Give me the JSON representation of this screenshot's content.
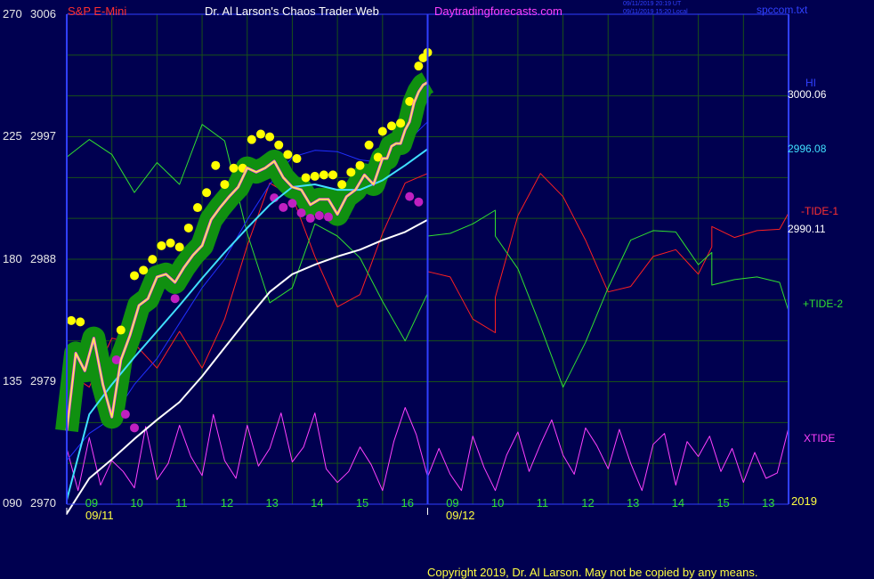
{
  "header": {
    "symbol": "S&P E-Mini",
    "title": "Dr. Al Larson's Chaos Trader Web",
    "site": "Daytradingforecasts.com",
    "stamp_line1": "09/11/2019 20:19 UT",
    "stamp_line2": "09/11/2019 15:20 Local",
    "file": "spccom.txt"
  },
  "copyright": "Copyright 2019, Dr. Al Larson. May not be copied by any means.",
  "colors": {
    "background": "#000050",
    "grid": "#185018",
    "frame": "#3040ff",
    "price": "#ffff40",
    "mid": "#ff40ff",
    "band": "#109010",
    "balls": "#ffff00",
    "low_balls": "#c020c0",
    "ma_fast": "#40e0ff",
    "ma_slow": "#ffffff",
    "ma_blue": "#2030ff",
    "tide1": "#ff2020",
    "tide2": "#30e030",
    "xtide": "#ff40ff"
  },
  "chart_data": {
    "type": "line",
    "title": "S&P E-Mini",
    "y_left_scale": [
      {
        "osc": "270",
        "price": "3006"
      },
      {
        "osc": "225",
        "price": "2997"
      },
      {
        "osc": "180",
        "price": "2988"
      },
      {
        "osc": "135",
        "price": "2979"
      },
      {
        "osc": "090",
        "price": "2970"
      }
    ],
    "ylim": [
      2970,
      3006
    ],
    "x_ticks": [
      "09",
      "10",
      "11",
      "12",
      "13",
      "14",
      "15",
      "16",
      "09",
      "10",
      "11",
      "12",
      "13",
      "14",
      "15",
      "13"
    ],
    "date_labels": [
      "09/11",
      "09/12"
    ],
    "year_label": "2019",
    "right_labels": {
      "hi_label": "HI",
      "hi_value": "3000.06",
      "ma_fast_value": "2996.08",
      "tide1": "-TIDE-1",
      "ma_slow_value": "2990.11",
      "tide2": "+TIDE-2",
      "xtide": "XTIDE"
    },
    "series": [
      {
        "key": "price",
        "x": [
          0.0,
          0.2,
          0.4,
          0.6,
          0.8,
          1.0,
          1.2,
          1.4,
          1.6,
          1.8,
          2.0,
          2.2,
          2.4,
          2.6,
          2.8,
          3.0,
          3.2,
          3.4,
          3.6,
          3.8,
          4.0,
          4.2,
          4.4,
          4.6,
          4.8,
          5.0,
          5.2,
          5.4,
          5.6,
          5.8,
          6.0,
          6.2,
          6.4,
          6.6,
          6.8,
          7.0,
          7.1,
          7.2,
          7.3,
          7.4,
          7.5,
          7.6,
          7.7,
          7.8,
          7.9,
          8.0
        ],
        "values": [
          2975.4,
          2981.1,
          2979.8,
          2982.2,
          2978.8,
          2976.4,
          2980.6,
          2982.4,
          2984.6,
          2985.1,
          2986.7,
          2986.9,
          2986.3,
          2987.4,
          2988.3,
          2989.0,
          2990.9,
          2991.8,
          2992.6,
          2993.3,
          2994.7,
          2994.4,
          2994.7,
          2995.2,
          2994.0,
          2993.3,
          2993.1,
          2992.0,
          2992.4,
          2992.4,
          2991.3,
          2992.6,
          2993.1,
          2994.2,
          2993.5,
          2995.4,
          2995.4,
          2996.3,
          2996.5,
          2996.5,
          2997.5,
          2998.1,
          2999.5,
          3000.3,
          3000.8,
          3001.0
        ]
      },
      {
        "key": "ma_fast",
        "x": [
          0,
          0.5,
          1,
          1.5,
          2,
          2.5,
          3,
          3.5,
          4,
          4.5,
          5,
          5.5,
          6,
          6.5,
          7,
          7.5,
          8
        ],
        "values": [
          2970.3,
          2976.6,
          2978.8,
          2980.8,
          2982.7,
          2984.6,
          2986.6,
          2988.5,
          2990.3,
          2992.0,
          2993.3,
          2993.5,
          2993.1,
          2993.1,
          2993.8,
          2994.9,
          2996.1
        ]
      },
      {
        "key": "ma_slow",
        "x": [
          0,
          0.5,
          1,
          1.5,
          2,
          2.5,
          3,
          3.5,
          4,
          4.5,
          5,
          5.5,
          6,
          6.5,
          7,
          7.5,
          8
        ],
        "values": [
          2969.3,
          2971.9,
          2973.3,
          2974.8,
          2976.2,
          2977.5,
          2979.4,
          2981.5,
          2983.6,
          2985.6,
          2986.9,
          2987.6,
          2988.2,
          2988.7,
          2989.4,
          2990.0,
          2990.9
        ]
      },
      {
        "key": "ma_blue",
        "x": [
          0,
          0.5,
          1,
          1.5,
          2,
          2.5,
          3,
          3.5,
          4,
          4.5,
          5,
          5.5,
          6,
          6.5,
          7,
          7.5,
          8
        ],
        "values": [
          2973.2,
          2975.2,
          2976.3,
          2978.8,
          2980.7,
          2983.3,
          2985.9,
          2988.0,
          2990.9,
          2993.5,
          2995.5,
          2996.0,
          2995.9,
          2995.3,
          2995.1,
          2996.5,
          2998.1
        ]
      },
      {
        "key": "tide1",
        "x": [
          0.0,
          0.5,
          1.0,
          1.5,
          2.0,
          2.5,
          3.0,
          3.5,
          4.0,
          4.5,
          5.0,
          5.5,
          6.0,
          6.5,
          7.0,
          7.5,
          8.0,
          8.0,
          8.5,
          9.0,
          9.5,
          9.5,
          10.0,
          10.5,
          11.0,
          11.5,
          12.0,
          12.5,
          13.0,
          13.5,
          14.0,
          14.3,
          14.3,
          14.8,
          15.3,
          15.8,
          16.0
        ],
        "values": [
          2979.7,
          2978.6,
          2982.2,
          2981.8,
          2980.0,
          2982.7,
          2980.0,
          2983.6,
          2989.0,
          2993.6,
          2992.6,
          2988.2,
          2984.5,
          2985.4,
          2989.9,
          2993.6,
          2994.3,
          2987.1,
          2986.7,
          2983.6,
          2982.6,
          2985.2,
          2991.2,
          2994.3,
          2992.6,
          2989.4,
          2985.6,
          2986.0,
          2988.2,
          2988.7,
          2986.9,
          2988.9,
          2990.4,
          2989.6,
          2990.1,
          2990.2,
          2991.4
        ]
      },
      {
        "key": "tide2",
        "x": [
          0.0,
          0.5,
          1.0,
          1.5,
          2.0,
          2.5,
          3.0,
          3.5,
          4.0,
          4.5,
          5.0,
          5.5,
          6.0,
          6.5,
          7.0,
          7.5,
          8.0,
          8.0,
          8.5,
          9.0,
          9.5,
          9.5,
          10.0,
          10.5,
          11.0,
          11.5,
          12.0,
          12.5,
          13.0,
          13.5,
          14.0,
          14.3,
          14.3,
          14.8,
          15.3,
          15.8,
          16.0
        ],
        "values": [
          2995.5,
          2996.8,
          2995.7,
          2992.9,
          2995.1,
          2993.5,
          2997.9,
          2996.7,
          2989.9,
          2984.8,
          2985.9,
          2990.6,
          2989.7,
          2988.1,
          2984.9,
          2982.0,
          2985.5,
          2989.7,
          2989.9,
          2990.6,
          2991.6,
          2989.7,
          2987.3,
          2983.1,
          2978.6,
          2981.9,
          2985.9,
          2989.4,
          2990.1,
          2990.0,
          2987.6,
          2988.5,
          2986.1,
          2986.5,
          2986.7,
          2986.3,
          2984.2
        ]
      },
      {
        "key": "xtide",
        "x": [
          0.0,
          0.25,
          0.5,
          0.75,
          1.0,
          1.25,
          1.5,
          1.75,
          2.0,
          2.25,
          2.5,
          2.75,
          3.0,
          3.25,
          3.5,
          3.75,
          4.0,
          4.25,
          4.5,
          4.75,
          5.0,
          5.25,
          5.5,
          5.75,
          6.0,
          6.25,
          6.5,
          6.75,
          7.0,
          7.25,
          7.5,
          7.75,
          8.0,
          8.25,
          8.5,
          8.75,
          9.0,
          9.25,
          9.5,
          9.75,
          10.0,
          10.25,
          10.5,
          10.75,
          11.0,
          11.25,
          11.5,
          11.75,
          12.0,
          12.25,
          12.5,
          12.75,
          13.0,
          13.25,
          13.5,
          13.75,
          14.0,
          14.25,
          14.5,
          14.75,
          15.0,
          15.25,
          15.5,
          15.75,
          16.0
        ],
        "values": [
          2974.1,
          2971.0,
          2974.9,
          2971.4,
          2973.2,
          2972.4,
          2971.2,
          2975.7,
          2971.8,
          2973.0,
          2975.8,
          2973.5,
          2972.1,
          2976.6,
          2973.2,
          2971.9,
          2975.8,
          2972.8,
          2974.1,
          2976.7,
          2973.1,
          2974.2,
          2976.7,
          2972.6,
          2971.6,
          2972.4,
          2974.2,
          2972.9,
          2971.0,
          2974.6,
          2977.1,
          2975.1,
          2972.0,
          2974.1,
          2972.2,
          2971.0,
          2975.0,
          2972.7,
          2971.0,
          2973.6,
          2975.3,
          2972.4,
          2974.4,
          2976.2,
          2973.6,
          2972.2,
          2975.6,
          2974.3,
          2972.6,
          2975.5,
          2973.0,
          2971.0,
          2974.4,
          2975.2,
          2971.4,
          2974.6,
          2973.5,
          2975.0,
          2972.4,
          2974.1,
          2971.6,
          2973.8,
          2971.9,
          2972.3,
          2975.6
        ]
      }
    ],
    "ball_highs": {
      "x": [
        0.1,
        0.3,
        1.2,
        1.5,
        1.7,
        1.9,
        2.1,
        2.3,
        2.5,
        2.7,
        2.9,
        3.1,
        3.3,
        3.5,
        3.7,
        3.9,
        4.1,
        4.3,
        4.5,
        4.7,
        4.9,
        5.1,
        5.3,
        5.5,
        5.7,
        5.9,
        6.1,
        6.3,
        6.5,
        6.7,
        6.9,
        7.0,
        7.2,
        7.4,
        7.6,
        7.8,
        7.9,
        8.0
      ],
      "values": [
        2983.1,
        2983.0,
        2982.4,
        2986.4,
        2986.8,
        2987.6,
        2988.6,
        2988.8,
        2988.5,
        2989.9,
        2991.4,
        2992.5,
        2994.5,
        2993.1,
        2994.3,
        2994.3,
        2996.4,
        2996.8,
        2996.6,
        2996.0,
        2995.3,
        2995.0,
        2993.6,
        2993.7,
        2993.8,
        2993.8,
        2993.1,
        2994.0,
        2994.5,
        2996.0,
        2995.1,
        2997.0,
        2997.4,
        2997.6,
        2999.2,
        3001.8,
        3002.4,
        3002.8
      ]
    },
    "ball_lows": {
      "x": [
        1.1,
        1.3,
        1.5,
        2.4,
        4.6,
        4.8,
        5.0,
        5.2,
        5.4,
        5.6,
        5.8,
        7.6,
        7.8
      ],
      "values": [
        2981.0,
        2977.0,
        2976.0,
        2985.5,
        2992.9,
        2992.2,
        2992.5,
        2991.8,
        2991.4,
        2991.6,
        2991.5,
        2993.0,
        2992.6
      ]
    }
  }
}
